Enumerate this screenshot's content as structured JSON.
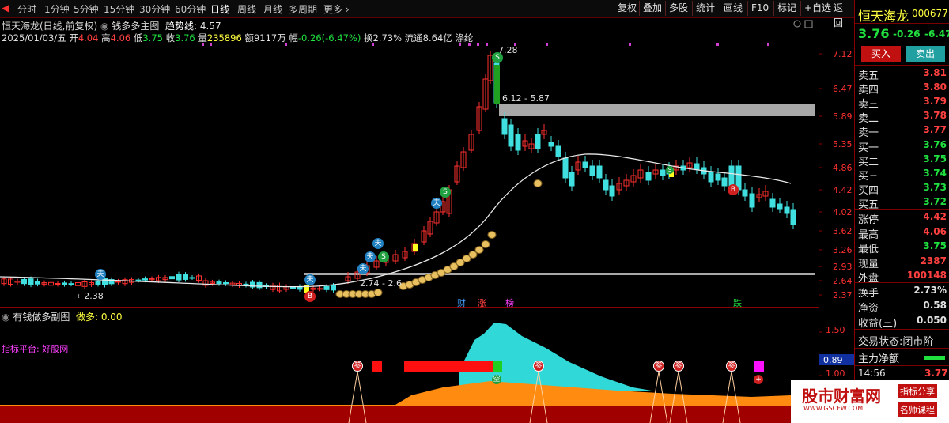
{
  "toolbar": {
    "periods": [
      "分时",
      "1分钟",
      "5分钟",
      "15分钟",
      "30分钟",
      "60分钟",
      "日线",
      "周线",
      "月线",
      "多周期",
      "更多 ›"
    ],
    "right": [
      "复权",
      "叠加",
      "多股",
      "统计",
      "画线",
      "F10",
      "标记",
      "+自选",
      "返回"
    ]
  },
  "header": {
    "title": "恒天海龙(日线,前复权)",
    "indicator": "钱多多主图",
    "trend_label": "趋势线:",
    "trend_value": "4.57",
    "date": "2025/01/03/五",
    "open_label": "开",
    "open": "4.04",
    "high_label": "高",
    "high": "4.06",
    "low_label": "低",
    "low": "3.75",
    "close_label": "收",
    "close": "3.76",
    "vol_label": "量",
    "vol": "235896",
    "amt_label": "额",
    "amt": "9117万",
    "chg_label": "幅",
    "chg": "-0.26(-6.47%)",
    "turnover_label": "换",
    "turnover": "2.73%",
    "float_label": "流通",
    "float": "8.64亿",
    "concept": "涤纶"
  },
  "main_chart": {
    "y_ticks": [
      "7.12",
      "6.47",
      "5.89",
      "5.35",
      "4.86",
      "4.42",
      "4.02",
      "3.62",
      "3.26",
      "2.93",
      "2.64",
      "2.37"
    ],
    "annotations": {
      "peak": "7.28",
      "zone": "6.12 - 5.87",
      "low": "2.38",
      "band": "2.74 - 2.6",
      "tag_cai": "财",
      "tag_zhang": "涨",
      "tag_bang": "榜",
      "tag_die": "跌"
    },
    "signal_fu": "夫",
    "signal_b": "B",
    "signal_s": "S",
    "signal_money": "$"
  },
  "sub_chart": {
    "title": "有钱做多副图",
    "label": "做多: 0.00",
    "platform": "指标平台: 好股网",
    "y_ticks": [
      "1.50",
      "1.00",
      "0.89"
    ],
    "marker_can": "参",
    "marker_kong": "空"
  },
  "right_panel": {
    "stock_name": "恒天海龙",
    "stock_code": "000677",
    "price": "3.76",
    "change": "-0.26",
    "change_pct": "-6.47",
    "buy_btn": "买入",
    "sell_btn": "卖出",
    "asks": [
      {
        "label": "卖五",
        "price": "3.81"
      },
      {
        "label": "卖四",
        "price": "3.80"
      },
      {
        "label": "卖三",
        "price": "3.79"
      },
      {
        "label": "卖二",
        "price": "3.78"
      },
      {
        "label": "卖一",
        "price": "3.77"
      }
    ],
    "bids": [
      {
        "label": "买一",
        "price": "3.76"
      },
      {
        "label": "买二",
        "price": "3.75"
      },
      {
        "label": "买三",
        "price": "3.74"
      },
      {
        "label": "买四",
        "price": "3.73"
      },
      {
        "label": "买五",
        "price": "3.72"
      }
    ],
    "stats": [
      {
        "label": "涨停",
        "value": "4.42"
      },
      {
        "label": "最高",
        "value": "4.06"
      },
      {
        "label": "最低",
        "value": "3.75"
      },
      {
        "label": "现量",
        "value": "2387"
      },
      {
        "label": "外盘",
        "value": "100148"
      }
    ],
    "stats2": [
      {
        "label": "换手",
        "value": "2.73%"
      },
      {
        "label": "净资",
        "value": "0.58"
      },
      {
        "label": "收益(三)",
        "value": "0.050"
      }
    ],
    "status": "交易状态:闭市阶",
    "flow": "主力净额",
    "tick_time": "14:56",
    "tick_price": "3.77",
    "watermark_main": "股市财富网",
    "watermark_url": "WWW.GSCFW.COM",
    "watermark_tag1": "指标分享",
    "watermark_tag2": "名师课程"
  },
  "colors": {
    "up": "#ff3030",
    "down": "#40e0e0",
    "accent": "#8b0000",
    "curve": "#e8e8e8"
  }
}
